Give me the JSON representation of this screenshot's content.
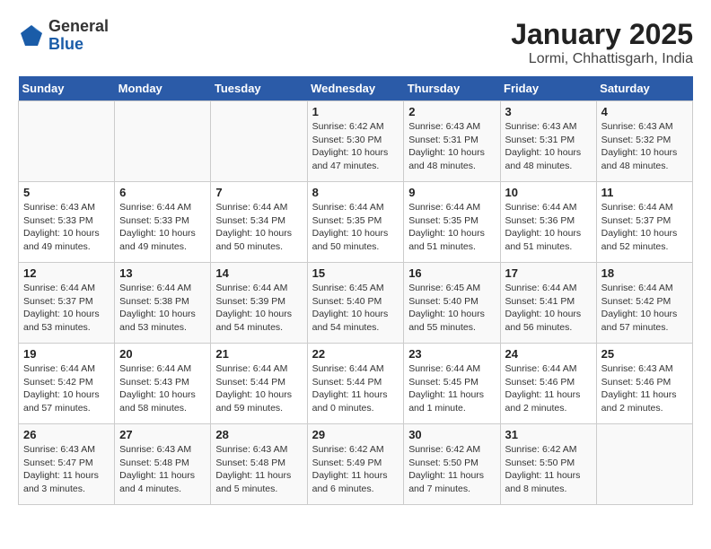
{
  "header": {
    "logo_general": "General",
    "logo_blue": "Blue",
    "month_year": "January 2025",
    "location": "Lormi, Chhattisgarh, India"
  },
  "days_of_week": [
    "Sunday",
    "Monday",
    "Tuesday",
    "Wednesday",
    "Thursday",
    "Friday",
    "Saturday"
  ],
  "weeks": [
    [
      {
        "num": "",
        "info": ""
      },
      {
        "num": "",
        "info": ""
      },
      {
        "num": "",
        "info": ""
      },
      {
        "num": "1",
        "info": "Sunrise: 6:42 AM\nSunset: 5:30 PM\nDaylight: 10 hours\nand 47 minutes."
      },
      {
        "num": "2",
        "info": "Sunrise: 6:43 AM\nSunset: 5:31 PM\nDaylight: 10 hours\nand 48 minutes."
      },
      {
        "num": "3",
        "info": "Sunrise: 6:43 AM\nSunset: 5:31 PM\nDaylight: 10 hours\nand 48 minutes."
      },
      {
        "num": "4",
        "info": "Sunrise: 6:43 AM\nSunset: 5:32 PM\nDaylight: 10 hours\nand 48 minutes."
      }
    ],
    [
      {
        "num": "5",
        "info": "Sunrise: 6:43 AM\nSunset: 5:33 PM\nDaylight: 10 hours\nand 49 minutes."
      },
      {
        "num": "6",
        "info": "Sunrise: 6:44 AM\nSunset: 5:33 PM\nDaylight: 10 hours\nand 49 minutes."
      },
      {
        "num": "7",
        "info": "Sunrise: 6:44 AM\nSunset: 5:34 PM\nDaylight: 10 hours\nand 50 minutes."
      },
      {
        "num": "8",
        "info": "Sunrise: 6:44 AM\nSunset: 5:35 PM\nDaylight: 10 hours\nand 50 minutes."
      },
      {
        "num": "9",
        "info": "Sunrise: 6:44 AM\nSunset: 5:35 PM\nDaylight: 10 hours\nand 51 minutes."
      },
      {
        "num": "10",
        "info": "Sunrise: 6:44 AM\nSunset: 5:36 PM\nDaylight: 10 hours\nand 51 minutes."
      },
      {
        "num": "11",
        "info": "Sunrise: 6:44 AM\nSunset: 5:37 PM\nDaylight: 10 hours\nand 52 minutes."
      }
    ],
    [
      {
        "num": "12",
        "info": "Sunrise: 6:44 AM\nSunset: 5:37 PM\nDaylight: 10 hours\nand 53 minutes."
      },
      {
        "num": "13",
        "info": "Sunrise: 6:44 AM\nSunset: 5:38 PM\nDaylight: 10 hours\nand 53 minutes."
      },
      {
        "num": "14",
        "info": "Sunrise: 6:44 AM\nSunset: 5:39 PM\nDaylight: 10 hours\nand 54 minutes."
      },
      {
        "num": "15",
        "info": "Sunrise: 6:45 AM\nSunset: 5:40 PM\nDaylight: 10 hours\nand 54 minutes."
      },
      {
        "num": "16",
        "info": "Sunrise: 6:45 AM\nSunset: 5:40 PM\nDaylight: 10 hours\nand 55 minutes."
      },
      {
        "num": "17",
        "info": "Sunrise: 6:44 AM\nSunset: 5:41 PM\nDaylight: 10 hours\nand 56 minutes."
      },
      {
        "num": "18",
        "info": "Sunrise: 6:44 AM\nSunset: 5:42 PM\nDaylight: 10 hours\nand 57 minutes."
      }
    ],
    [
      {
        "num": "19",
        "info": "Sunrise: 6:44 AM\nSunset: 5:42 PM\nDaylight: 10 hours\nand 57 minutes."
      },
      {
        "num": "20",
        "info": "Sunrise: 6:44 AM\nSunset: 5:43 PM\nDaylight: 10 hours\nand 58 minutes."
      },
      {
        "num": "21",
        "info": "Sunrise: 6:44 AM\nSunset: 5:44 PM\nDaylight: 10 hours\nand 59 minutes."
      },
      {
        "num": "22",
        "info": "Sunrise: 6:44 AM\nSunset: 5:44 PM\nDaylight: 11 hours\nand 0 minutes."
      },
      {
        "num": "23",
        "info": "Sunrise: 6:44 AM\nSunset: 5:45 PM\nDaylight: 11 hours\nand 1 minute."
      },
      {
        "num": "24",
        "info": "Sunrise: 6:44 AM\nSunset: 5:46 PM\nDaylight: 11 hours\nand 2 minutes."
      },
      {
        "num": "25",
        "info": "Sunrise: 6:43 AM\nSunset: 5:46 PM\nDaylight: 11 hours\nand 2 minutes."
      }
    ],
    [
      {
        "num": "26",
        "info": "Sunrise: 6:43 AM\nSunset: 5:47 PM\nDaylight: 11 hours\nand 3 minutes."
      },
      {
        "num": "27",
        "info": "Sunrise: 6:43 AM\nSunset: 5:48 PM\nDaylight: 11 hours\nand 4 minutes."
      },
      {
        "num": "28",
        "info": "Sunrise: 6:43 AM\nSunset: 5:48 PM\nDaylight: 11 hours\nand 5 minutes."
      },
      {
        "num": "29",
        "info": "Sunrise: 6:42 AM\nSunset: 5:49 PM\nDaylight: 11 hours\nand 6 minutes."
      },
      {
        "num": "30",
        "info": "Sunrise: 6:42 AM\nSunset: 5:50 PM\nDaylight: 11 hours\nand 7 minutes."
      },
      {
        "num": "31",
        "info": "Sunrise: 6:42 AM\nSunset: 5:50 PM\nDaylight: 11 hours\nand 8 minutes."
      },
      {
        "num": "",
        "info": ""
      }
    ]
  ]
}
